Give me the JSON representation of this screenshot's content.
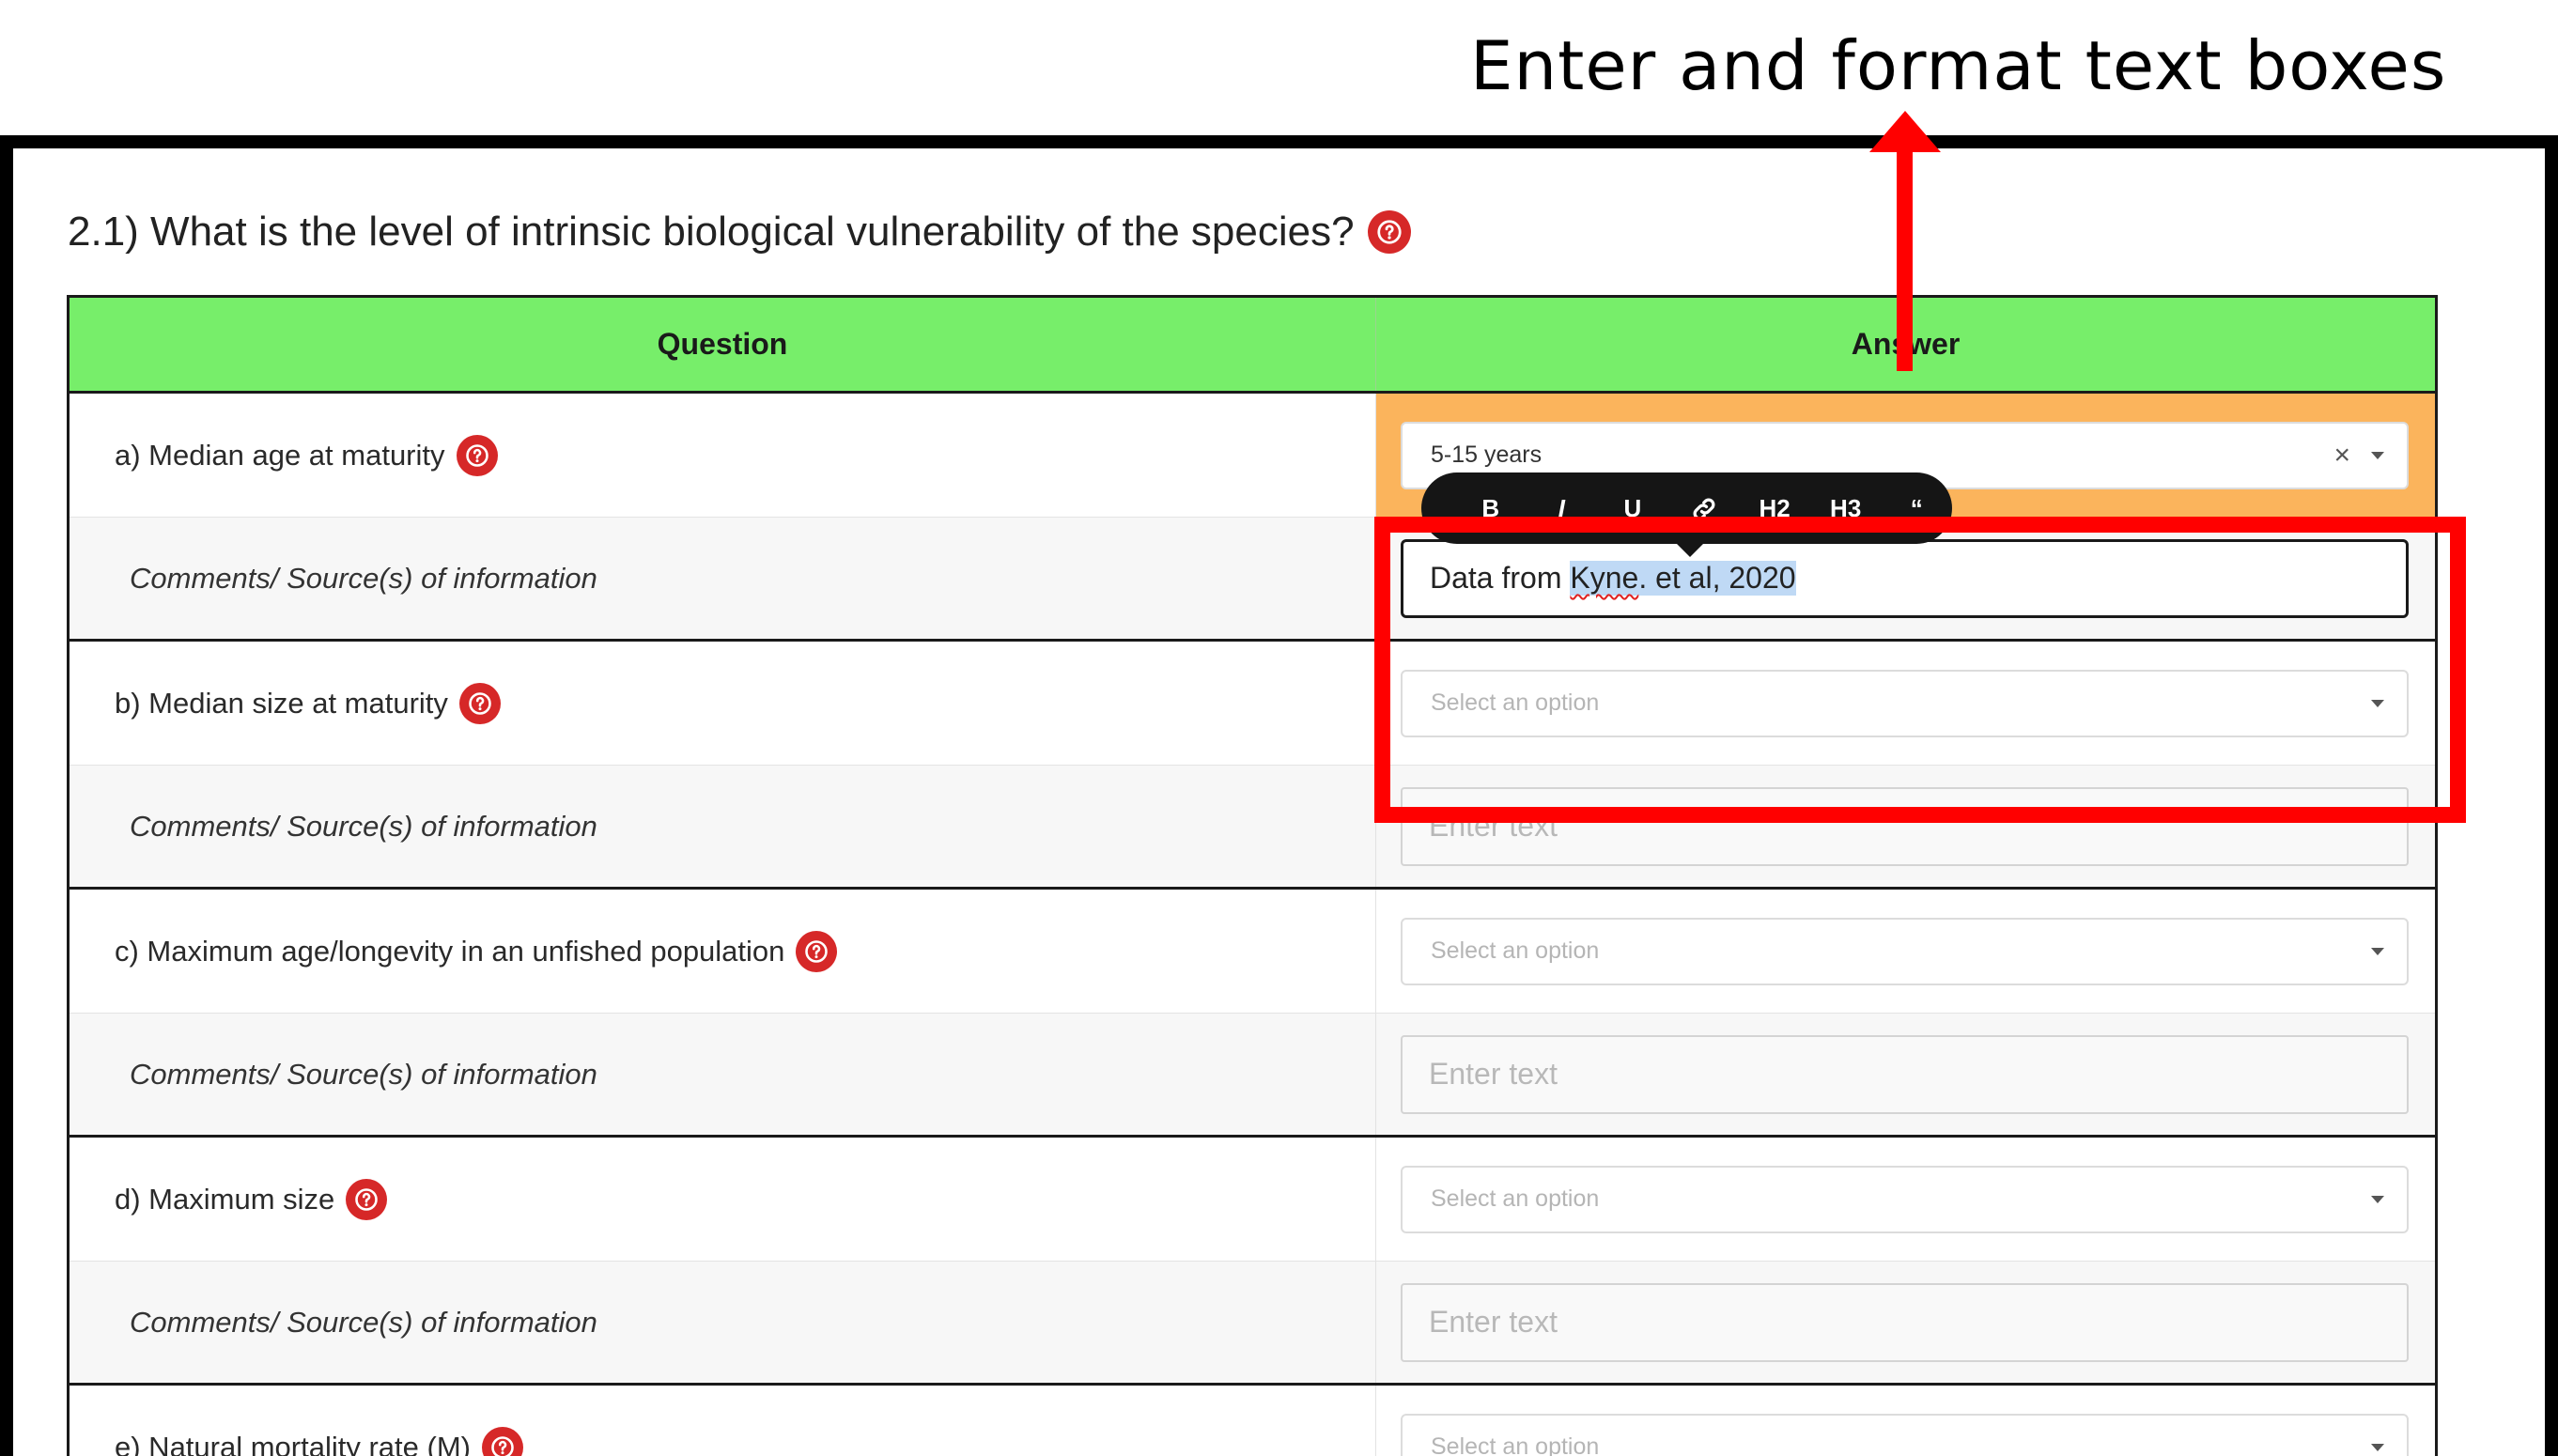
{
  "annotation": {
    "title": "Enter and format text boxes"
  },
  "section": {
    "title": "2.1) What is the level of intrinsic biological vulnerability of the species?"
  },
  "table": {
    "header_question": "Question",
    "header_answer": "Answer"
  },
  "toolbar": {
    "bold": "B",
    "italic": "I",
    "underline": "U",
    "link_icon": "link-icon",
    "h2": "H2",
    "h3": "H3",
    "quote": "“"
  },
  "questions": [
    {
      "label": "a) Median age at maturity",
      "select_value": "5-15 years",
      "comment_label": "Comments/ Source(s) of information",
      "comment_text_before": "Data from ",
      "comment_text_misspelled": "Kyne",
      "comment_text_after": ". et al, 2020"
    },
    {
      "label": "b) Median size at maturity",
      "select_placeholder": "Select an option",
      "comment_label": "Comments/ Source(s) of information",
      "comment_placeholder": "Enter text"
    },
    {
      "label": "c) Maximum age/longevity in an unfished population",
      "select_placeholder": "Select an option",
      "comment_label": "Comments/ Source(s) of information",
      "comment_placeholder": "Enter text"
    },
    {
      "label": "d) Maximum size",
      "select_placeholder": "Select an option",
      "comment_label": "Comments/ Source(s) of information",
      "comment_placeholder": "Enter text"
    },
    {
      "label": "e) Natural mortality rate (M)",
      "select_placeholder": "Select an option"
    }
  ],
  "colors": {
    "header_green": "#77ee6a",
    "answer_highlight": "#fbb45c",
    "help_icon_red": "#d62828",
    "annotation_red": "#ff0000",
    "text_selection": "#bfd9f5"
  }
}
